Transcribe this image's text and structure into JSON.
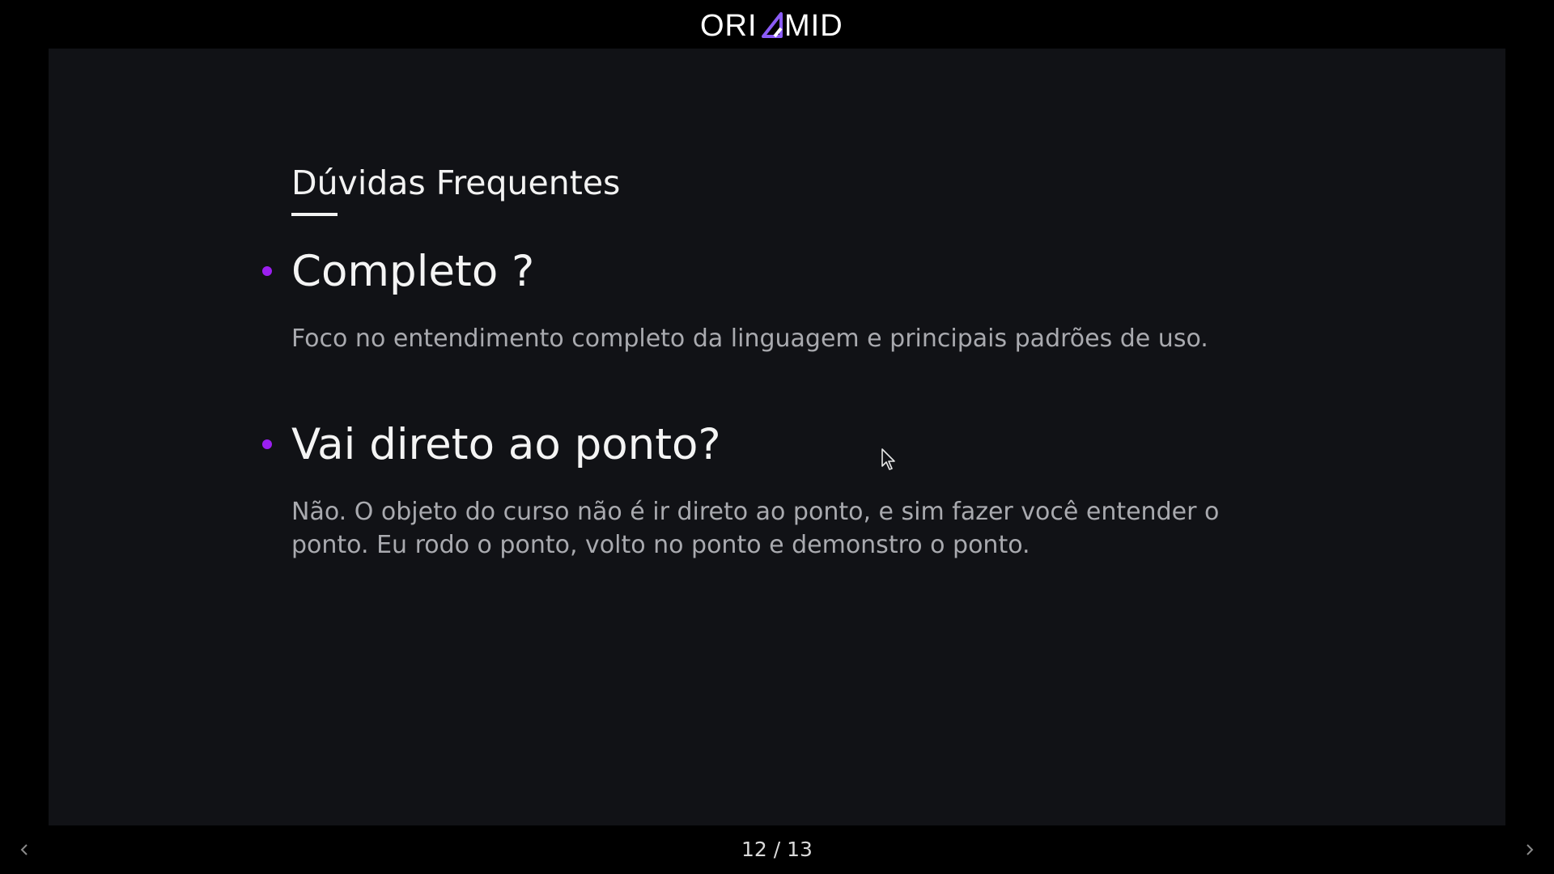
{
  "brand": {
    "logo_text": "ORIGAMID",
    "accent_color": "#8b5cf6"
  },
  "slide": {
    "title": "Dúvidas Frequentes",
    "items": [
      {
        "question": "Completo ?",
        "answer": "Foco no entendimento completo da linguagem e principais padrões de uso."
      },
      {
        "question": "Vai direto ao ponto?",
        "answer": "Não. O objeto do curso não é ir direto ao ponto, e sim fazer você entender o ponto. Eu rodo o ponto, volto no ponto e demonstro o ponto."
      }
    ],
    "bullet_color": "#9b1ff0",
    "background_color": "#111216"
  },
  "footer": {
    "page_counter": "12 / 13",
    "current_page": 12,
    "total_pages": 13
  },
  "icons": {
    "prev": "chevron-left-icon",
    "next": "chevron-right-icon",
    "cursor": "mouse-pointer-icon"
  }
}
